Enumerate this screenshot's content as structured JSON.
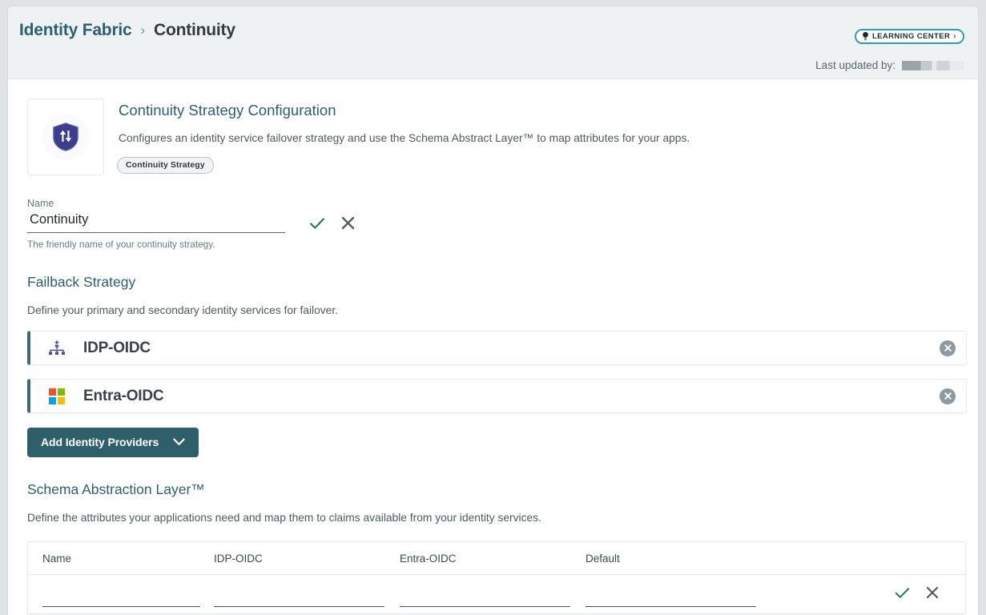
{
  "header": {
    "breadcrumb_root": "Identity Fabric",
    "breadcrumb_sep": "›",
    "breadcrumb_leaf": "Continuity",
    "learning_center_label": "LEARNING CENTER",
    "learning_center_chevron": "›",
    "last_updated_label": "Last updated by:",
    "last_updated_value": ""
  },
  "intro": {
    "title": "Continuity Strategy Configuration",
    "description": "Configures an identity service failover strategy and use the Schema Abstract Layer™ to map attributes for your apps.",
    "pill": "Continuity Strategy"
  },
  "name_field": {
    "label": "Name",
    "value": "Continuity",
    "placeholder": "Name",
    "hint": "The friendly name of your continuity strategy."
  },
  "failback": {
    "heading": "Failback Strategy",
    "subtext": "Define your primary and secondary identity services for failover.",
    "providers": [
      {
        "name": "IDP-OIDC",
        "icon": "hierarchy-icon"
      },
      {
        "name": "Entra-OIDC",
        "icon": "microsoft-icon"
      }
    ],
    "add_button": "Add Identity Providers"
  },
  "schema": {
    "heading": "Schema Abstraction Layer™",
    "subtext": "Define the attributes your applications need and map them to claims available from your identity services.",
    "columns": [
      "Name",
      "IDP-OIDC",
      "Entra-OIDC",
      "Default"
    ],
    "new_row": {
      "name": "",
      "idp_oidc": "",
      "entra_oidc": "",
      "default": ""
    }
  },
  "colors": {
    "accent_teal": "#2b6070",
    "button_teal": "#2d6068",
    "row_accent": "#3c6a79",
    "confirm_green": "#18795a",
    "header_band": "#eef2f3",
    "shield_indigo": "#3b3d8f"
  }
}
